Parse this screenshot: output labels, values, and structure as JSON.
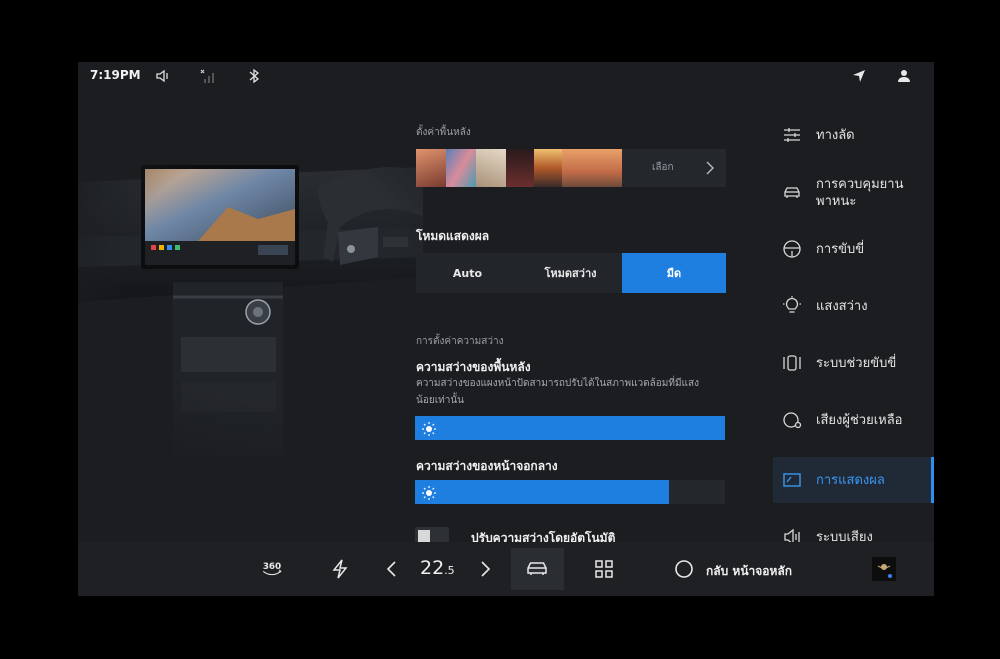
{
  "status_bar": {
    "time": "7:19PM",
    "icons": [
      "speaker-icon",
      "signal-icon",
      "bluetooth-icon",
      "location-icon",
      "user-icon"
    ]
  },
  "settings": {
    "wallpaper": {
      "section_label": "ตั้งค่าพื้นหลัง",
      "choose_label": "เลือก",
      "thumbnail_colors": [
        "#c9806b",
        "#6a88b0",
        "#c7b9a6",
        "#3b2a2a",
        "#d79a4f",
        "#d07a54"
      ]
    },
    "display_mode": {
      "heading": "โหมดแสดงผล",
      "options": [
        "Auto",
        "โหมดสว่าง",
        "มืด"
      ],
      "selected": "มืด"
    },
    "brightness": {
      "section_label": "การตั้งค่าความสว่าง",
      "background": {
        "heading": "ความสว่างของพื้นหลัง",
        "description": "ความสว่างของแผงหน้าปัดสามารถปรับได้ในสภาพแวดล้อมที่มีแสงน้อยเท่านั้น",
        "level": 1.0
      },
      "center_screen": {
        "heading": "ความสว่างของหน้าจอกลาง",
        "level": 0.82
      },
      "auto_adjust_label": "ปรับความสว่างโดยอัตโนมัติ"
    }
  },
  "nav": {
    "items": [
      {
        "label": "ทางลัด",
        "icon": "sliders-icon"
      },
      {
        "label": "การควบคุมยานพาหนะ",
        "icon": "car-icon"
      },
      {
        "label": "การขับขี่",
        "icon": "steering-wheel-icon"
      },
      {
        "label": "แสงสว่าง",
        "icon": "bulb-icon"
      },
      {
        "label": "ระบบช่วยขับขี่",
        "icon": "assist-icon"
      },
      {
        "label": "เสียงผู้ช่วยเหลือ",
        "icon": "voice-assistant-icon"
      },
      {
        "label": "การแสดงผล",
        "icon": "display-icon"
      },
      {
        "label": "ระบบเสียง",
        "icon": "sound-icon"
      }
    ],
    "active": "การแสดงผล"
  },
  "dock": {
    "view_360_label": "360",
    "temperature_whole": "22",
    "temperature_decimal": ".5",
    "home_label": "กลับ หน้าจอหลัก"
  },
  "colors": {
    "accent": "#1f7fe0",
    "active_nav_text": "#3a96f2",
    "background": "#1b1d20"
  }
}
